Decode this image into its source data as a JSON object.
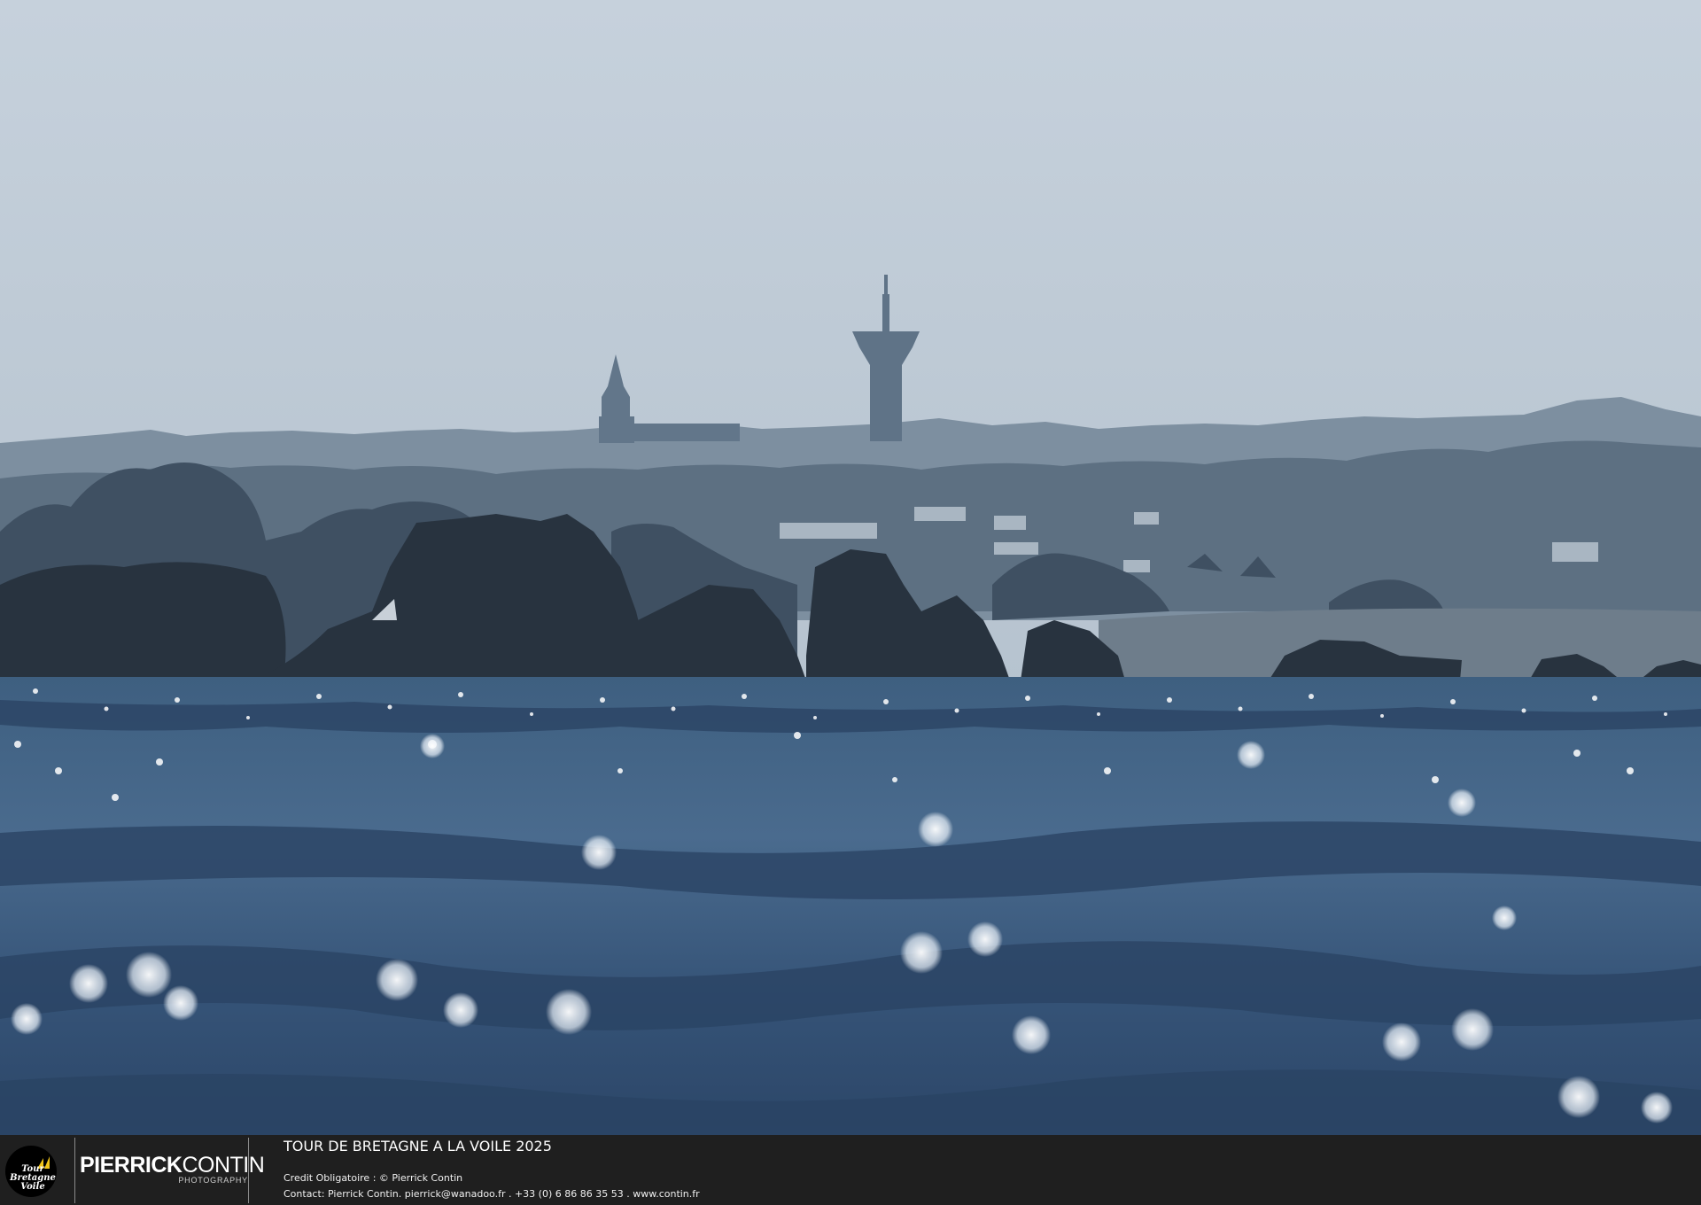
{
  "photo": {
    "subject": "coastal-seascape",
    "colors": {
      "sky": "#c8d3dd",
      "haze": "#aebbc6",
      "far_land": "#6f8293",
      "mid_land": "#4a5a69",
      "rocks": "#27323f",
      "sea": "#3d5c7e",
      "sea_dark": "#2a4462",
      "sparkle": "#ffffff"
    }
  },
  "caption": {
    "title": "TOUR DE BRETAGNE A LA VOILE 2025",
    "credit": "Credit Obligatoire : © Pierrick Contin",
    "contact": "Contact: Pierrick Contin. pierrick@wanadoo.fr . +33 (0) 6 86 86 35 53 . www.contin.fr"
  },
  "event_logo": {
    "text": "Tour\nBretagne\nVoile",
    "accent": "#f0c419"
  },
  "brand": {
    "name_first": "PIERRICK",
    "name_second": "CONTIN",
    "subtitle": "PHOTOGRAPHY"
  }
}
